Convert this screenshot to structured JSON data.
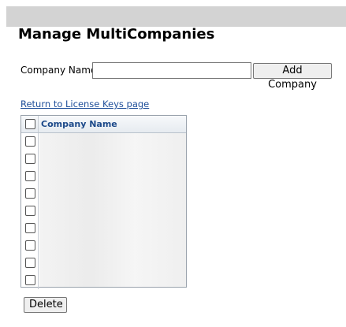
{
  "page": {
    "title": "Manage MultiCompanies",
    "company_name_label": "Company Name:",
    "company_name_value": "",
    "add_company_label": "Add Company",
    "return_link": "Return to License Keys page",
    "delete_label": "Delete"
  },
  "grid": {
    "header": "Company Name",
    "rows": [
      "",
      "",
      "",
      "",
      "",
      "",
      "",
      "",
      ""
    ]
  }
}
